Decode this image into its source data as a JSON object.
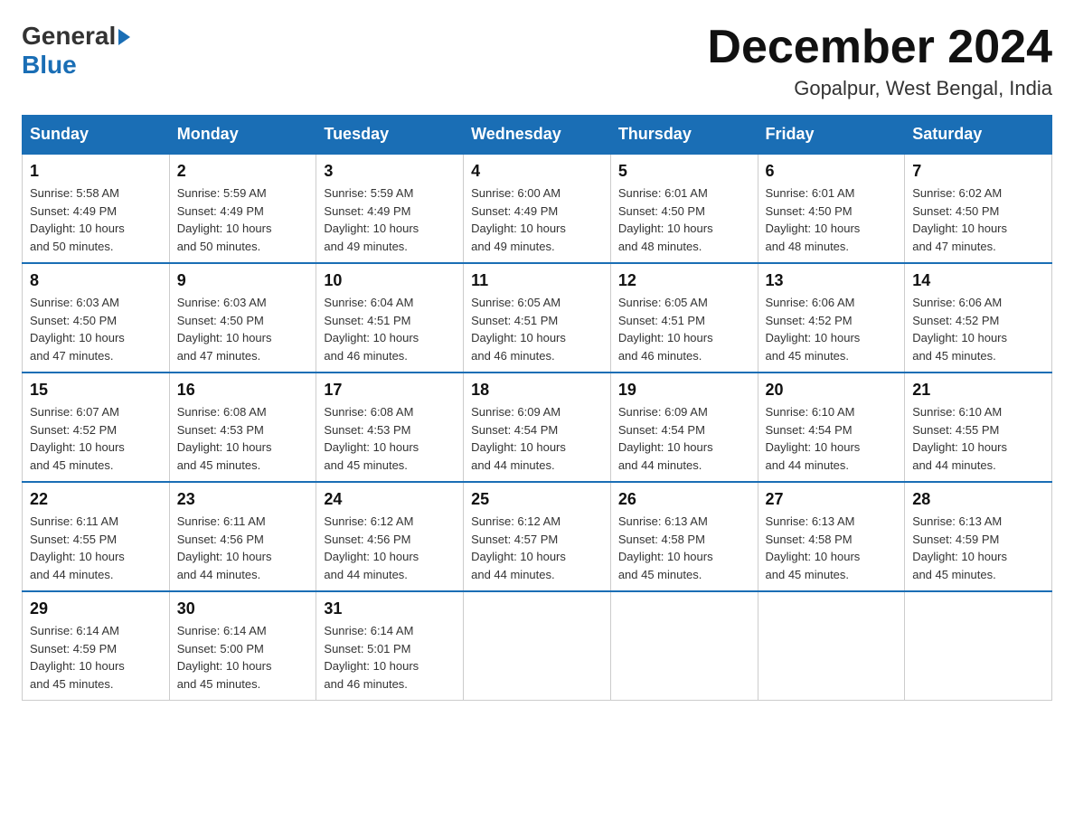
{
  "logo": {
    "general": "General",
    "blue": "Blue",
    "arrow": "▶"
  },
  "title": "December 2024",
  "location": "Gopalpur, West Bengal, India",
  "days_of_week": [
    "Sunday",
    "Monday",
    "Tuesday",
    "Wednesday",
    "Thursday",
    "Friday",
    "Saturday"
  ],
  "weeks": [
    [
      {
        "day": 1,
        "info": "Sunrise: 5:58 AM\nSunset: 4:49 PM\nDaylight: 10 hours\nand 50 minutes."
      },
      {
        "day": 2,
        "info": "Sunrise: 5:59 AM\nSunset: 4:49 PM\nDaylight: 10 hours\nand 50 minutes."
      },
      {
        "day": 3,
        "info": "Sunrise: 5:59 AM\nSunset: 4:49 PM\nDaylight: 10 hours\nand 49 minutes."
      },
      {
        "day": 4,
        "info": "Sunrise: 6:00 AM\nSunset: 4:49 PM\nDaylight: 10 hours\nand 49 minutes."
      },
      {
        "day": 5,
        "info": "Sunrise: 6:01 AM\nSunset: 4:50 PM\nDaylight: 10 hours\nand 48 minutes."
      },
      {
        "day": 6,
        "info": "Sunrise: 6:01 AM\nSunset: 4:50 PM\nDaylight: 10 hours\nand 48 minutes."
      },
      {
        "day": 7,
        "info": "Sunrise: 6:02 AM\nSunset: 4:50 PM\nDaylight: 10 hours\nand 47 minutes."
      }
    ],
    [
      {
        "day": 8,
        "info": "Sunrise: 6:03 AM\nSunset: 4:50 PM\nDaylight: 10 hours\nand 47 minutes."
      },
      {
        "day": 9,
        "info": "Sunrise: 6:03 AM\nSunset: 4:50 PM\nDaylight: 10 hours\nand 47 minutes."
      },
      {
        "day": 10,
        "info": "Sunrise: 6:04 AM\nSunset: 4:51 PM\nDaylight: 10 hours\nand 46 minutes."
      },
      {
        "day": 11,
        "info": "Sunrise: 6:05 AM\nSunset: 4:51 PM\nDaylight: 10 hours\nand 46 minutes."
      },
      {
        "day": 12,
        "info": "Sunrise: 6:05 AM\nSunset: 4:51 PM\nDaylight: 10 hours\nand 46 minutes."
      },
      {
        "day": 13,
        "info": "Sunrise: 6:06 AM\nSunset: 4:52 PM\nDaylight: 10 hours\nand 45 minutes."
      },
      {
        "day": 14,
        "info": "Sunrise: 6:06 AM\nSunset: 4:52 PM\nDaylight: 10 hours\nand 45 minutes."
      }
    ],
    [
      {
        "day": 15,
        "info": "Sunrise: 6:07 AM\nSunset: 4:52 PM\nDaylight: 10 hours\nand 45 minutes."
      },
      {
        "day": 16,
        "info": "Sunrise: 6:08 AM\nSunset: 4:53 PM\nDaylight: 10 hours\nand 45 minutes."
      },
      {
        "day": 17,
        "info": "Sunrise: 6:08 AM\nSunset: 4:53 PM\nDaylight: 10 hours\nand 45 minutes."
      },
      {
        "day": 18,
        "info": "Sunrise: 6:09 AM\nSunset: 4:54 PM\nDaylight: 10 hours\nand 44 minutes."
      },
      {
        "day": 19,
        "info": "Sunrise: 6:09 AM\nSunset: 4:54 PM\nDaylight: 10 hours\nand 44 minutes."
      },
      {
        "day": 20,
        "info": "Sunrise: 6:10 AM\nSunset: 4:54 PM\nDaylight: 10 hours\nand 44 minutes."
      },
      {
        "day": 21,
        "info": "Sunrise: 6:10 AM\nSunset: 4:55 PM\nDaylight: 10 hours\nand 44 minutes."
      }
    ],
    [
      {
        "day": 22,
        "info": "Sunrise: 6:11 AM\nSunset: 4:55 PM\nDaylight: 10 hours\nand 44 minutes."
      },
      {
        "day": 23,
        "info": "Sunrise: 6:11 AM\nSunset: 4:56 PM\nDaylight: 10 hours\nand 44 minutes."
      },
      {
        "day": 24,
        "info": "Sunrise: 6:12 AM\nSunset: 4:56 PM\nDaylight: 10 hours\nand 44 minutes."
      },
      {
        "day": 25,
        "info": "Sunrise: 6:12 AM\nSunset: 4:57 PM\nDaylight: 10 hours\nand 44 minutes."
      },
      {
        "day": 26,
        "info": "Sunrise: 6:13 AM\nSunset: 4:58 PM\nDaylight: 10 hours\nand 45 minutes."
      },
      {
        "day": 27,
        "info": "Sunrise: 6:13 AM\nSunset: 4:58 PM\nDaylight: 10 hours\nand 45 minutes."
      },
      {
        "day": 28,
        "info": "Sunrise: 6:13 AM\nSunset: 4:59 PM\nDaylight: 10 hours\nand 45 minutes."
      }
    ],
    [
      {
        "day": 29,
        "info": "Sunrise: 6:14 AM\nSunset: 4:59 PM\nDaylight: 10 hours\nand 45 minutes."
      },
      {
        "day": 30,
        "info": "Sunrise: 6:14 AM\nSunset: 5:00 PM\nDaylight: 10 hours\nand 45 minutes."
      },
      {
        "day": 31,
        "info": "Sunrise: 6:14 AM\nSunset: 5:01 PM\nDaylight: 10 hours\nand 46 minutes."
      },
      null,
      null,
      null,
      null
    ]
  ]
}
